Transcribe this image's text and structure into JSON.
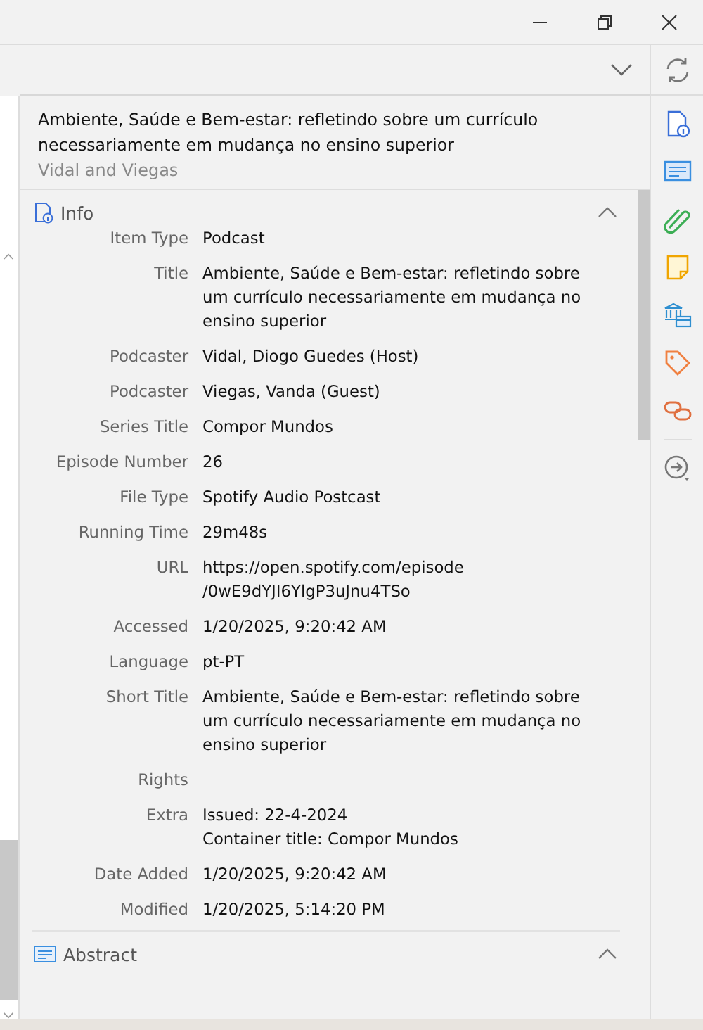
{
  "header": {
    "title_lines": [
      "Ambiente, Saúde e Bem-estar: refletindo sobre um currículo",
      "necessariamente em mudança no ensino superior"
    ],
    "creators": "Vidal and Viegas"
  },
  "sections": [
    {
      "kind": "info",
      "title": "Info",
      "expanded": true
    },
    {
      "kind": "abstract",
      "title": "Abstract",
      "expanded": true
    }
  ],
  "fields": [
    {
      "label": "Item Type",
      "value": [
        "Podcast"
      ]
    },
    {
      "label": "Title",
      "value": [
        "Ambiente, Saúde e Bem-estar: refletindo sobre",
        "um currículo necessariamente em mudança no",
        "ensino superior"
      ]
    },
    {
      "label": "Podcaster",
      "value": [
        "Vidal, Diogo Guedes (Host)"
      ]
    },
    {
      "label": "Podcaster",
      "value": [
        "Viegas, Vanda (Guest)"
      ]
    },
    {
      "label": "Series Title",
      "value": [
        "Compor Mundos"
      ]
    },
    {
      "label": "Episode Number",
      "value": [
        "26"
      ]
    },
    {
      "label": "File Type",
      "value": [
        "Spotify Audio Postcast"
      ]
    },
    {
      "label": "Running Time",
      "value": [
        "29m48s"
      ]
    },
    {
      "label": "URL",
      "value": [
        "https://open.spotify.com/episode",
        "/0wE9dYJI6YlgP3uJnu4TSo"
      ]
    },
    {
      "label": "Accessed",
      "value": [
        "1/20/2025, 9:20:42 AM"
      ]
    },
    {
      "label": "Language",
      "value": [
        "pt-PT"
      ]
    },
    {
      "label": "Short Title",
      "value": [
        "Ambiente, Saúde e Bem-estar: refletindo sobre",
        "um currículo necessariamente em mudança no",
        "ensino superior"
      ]
    },
    {
      "label": "Rights"
    },
    {
      "label": "Extra",
      "value": [
        "Issued: 22-4-2024",
        "Container title: Compor Mundos"
      ]
    },
    {
      "label": "Date Added",
      "value": [
        "1/20/2025, 9:20:42 AM"
      ]
    },
    {
      "label": "Modified",
      "value": [
        "1/20/2025, 5:14:20 PM"
      ]
    }
  ],
  "sidenav": [
    {
      "kind": "info",
      "selected": false
    },
    {
      "kind": "abstract",
      "selected": false
    },
    {
      "kind": "attachments",
      "selected": false
    },
    {
      "kind": "notes",
      "selected": false
    },
    {
      "kind": "libraries",
      "selected": false
    },
    {
      "kind": "tags",
      "selected": false
    },
    {
      "kind": "related",
      "selected": false
    }
  ]
}
